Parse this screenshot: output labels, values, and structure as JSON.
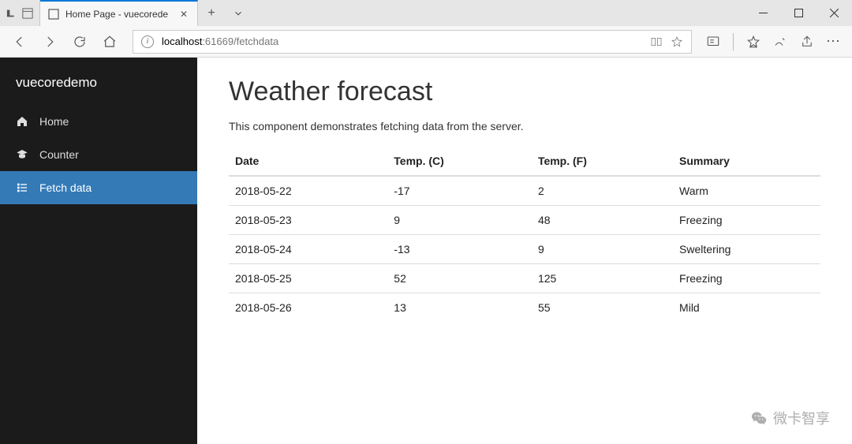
{
  "browser": {
    "tab_title": "Home Page - vuecorede",
    "new_tab": "+",
    "url_host": "localhost",
    "url_rest": ":61669/fetchdata"
  },
  "sidebar": {
    "brand": "vuecoredemo",
    "items": [
      {
        "label": "Home"
      },
      {
        "label": "Counter"
      },
      {
        "label": "Fetch data"
      }
    ]
  },
  "main": {
    "title": "Weather forecast",
    "subtitle": "This component demonstrates fetching data from the server.",
    "columns": [
      "Date",
      "Temp. (C)",
      "Temp. (F)",
      "Summary"
    ],
    "rows": [
      {
        "date": "2018-05-22",
        "tc": "-17",
        "tf": "2",
        "summary": "Warm"
      },
      {
        "date": "2018-05-23",
        "tc": "9",
        "tf": "48",
        "summary": "Freezing"
      },
      {
        "date": "2018-05-24",
        "tc": "-13",
        "tf": "9",
        "summary": "Sweltering"
      },
      {
        "date": "2018-05-25",
        "tc": "52",
        "tf": "125",
        "summary": "Freezing"
      },
      {
        "date": "2018-05-26",
        "tc": "13",
        "tf": "55",
        "summary": "Mild"
      }
    ]
  },
  "watermark": "微卡智享"
}
